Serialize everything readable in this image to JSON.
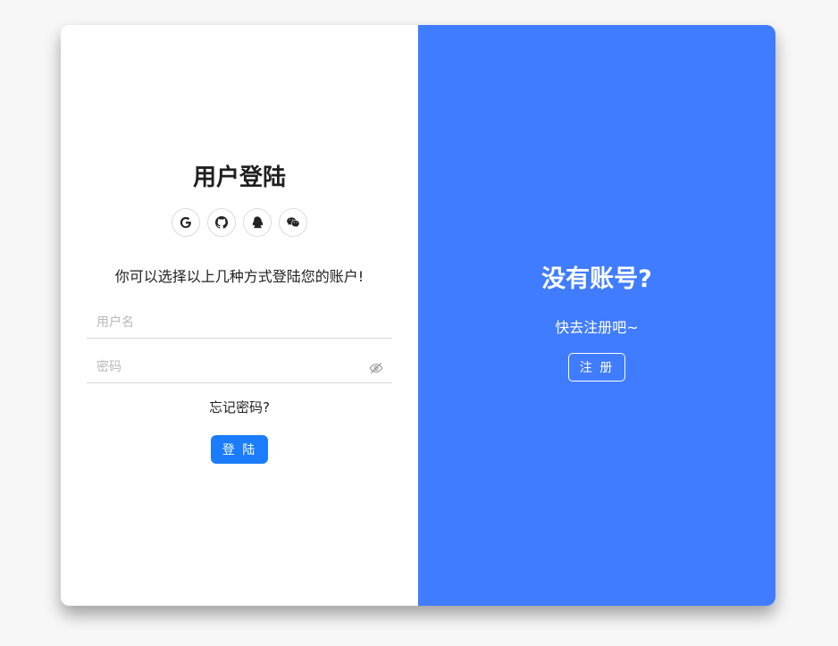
{
  "login": {
    "title": "用户登陆",
    "social_icons": [
      "google-icon",
      "github-icon",
      "qq-icon",
      "wechat-icon"
    ],
    "hint": "你可以选择以上几种方式登陆您的账户!",
    "username_placeholder": "用户名",
    "username_value": "",
    "password_placeholder": "密码",
    "password_value": "",
    "forgot_label": "忘记密码?",
    "login_button": "登 陆"
  },
  "register": {
    "title": "没有账号?",
    "subtitle": "快去注册吧~",
    "register_button": "注 册"
  },
  "colors": {
    "page_bg": "#f7f7f7",
    "panel_blue": "#407cff",
    "button_blue": "#1b7cff"
  }
}
